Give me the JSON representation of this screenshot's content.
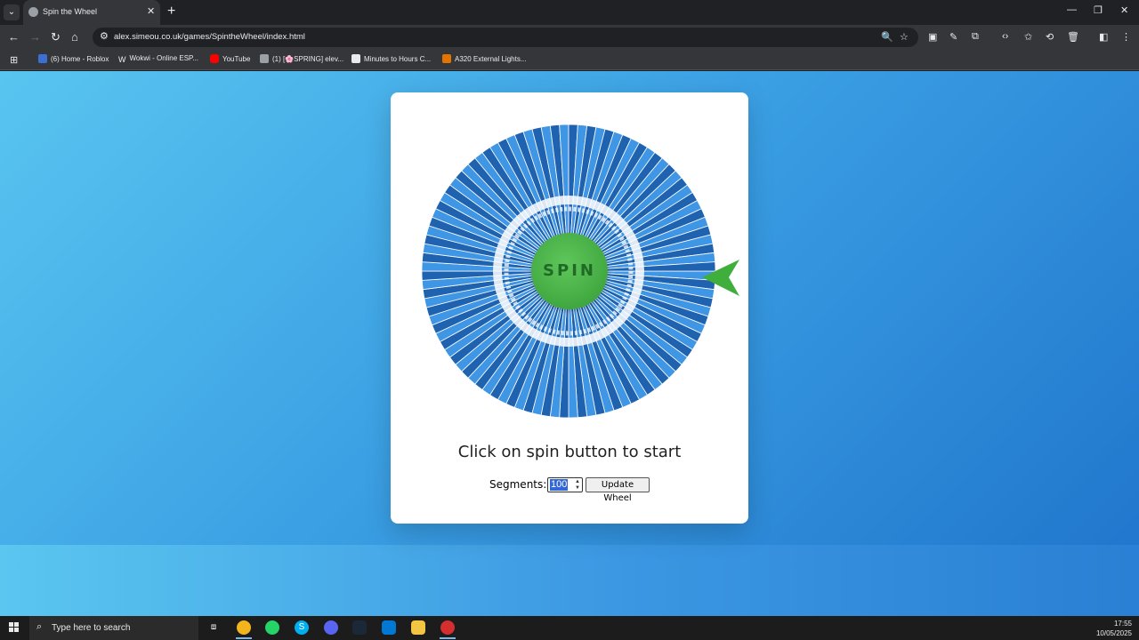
{
  "browser": {
    "tab_title": "Spin the Wheel",
    "url": "alex.simeou.co.uk/games/SpintheWheel/index.html",
    "bookmarks": [
      {
        "label": "(6) Home - Roblox",
        "color": "#3c6fd6"
      },
      {
        "label": "Wokwi - Online ESP...",
        "color": "#e8eaed"
      },
      {
        "label": "YouTube",
        "color": "#ff0000"
      },
      {
        "label": "(1) [🌸SPRING] elev...",
        "color": "#9aa0a6"
      },
      {
        "label": "Minutes to Hours C...",
        "color": "#e8eaed"
      },
      {
        "label": "A320 External Lights...",
        "color": "#e37400"
      }
    ]
  },
  "wheel": {
    "segments": 100,
    "colors": [
      "#3f96e5",
      "#1f62b0"
    ],
    "spin_label": "SPIN",
    "pointer_color": "#3fae3c"
  },
  "status_text": "Click on spin button to start",
  "controls": {
    "segments_label": "Segments:",
    "segments_value": "100",
    "update_label": "Update Wheel"
  },
  "taskbar": {
    "search_placeholder": "Type here to search",
    "time": "17:55",
    "date": "10/05/2025"
  }
}
